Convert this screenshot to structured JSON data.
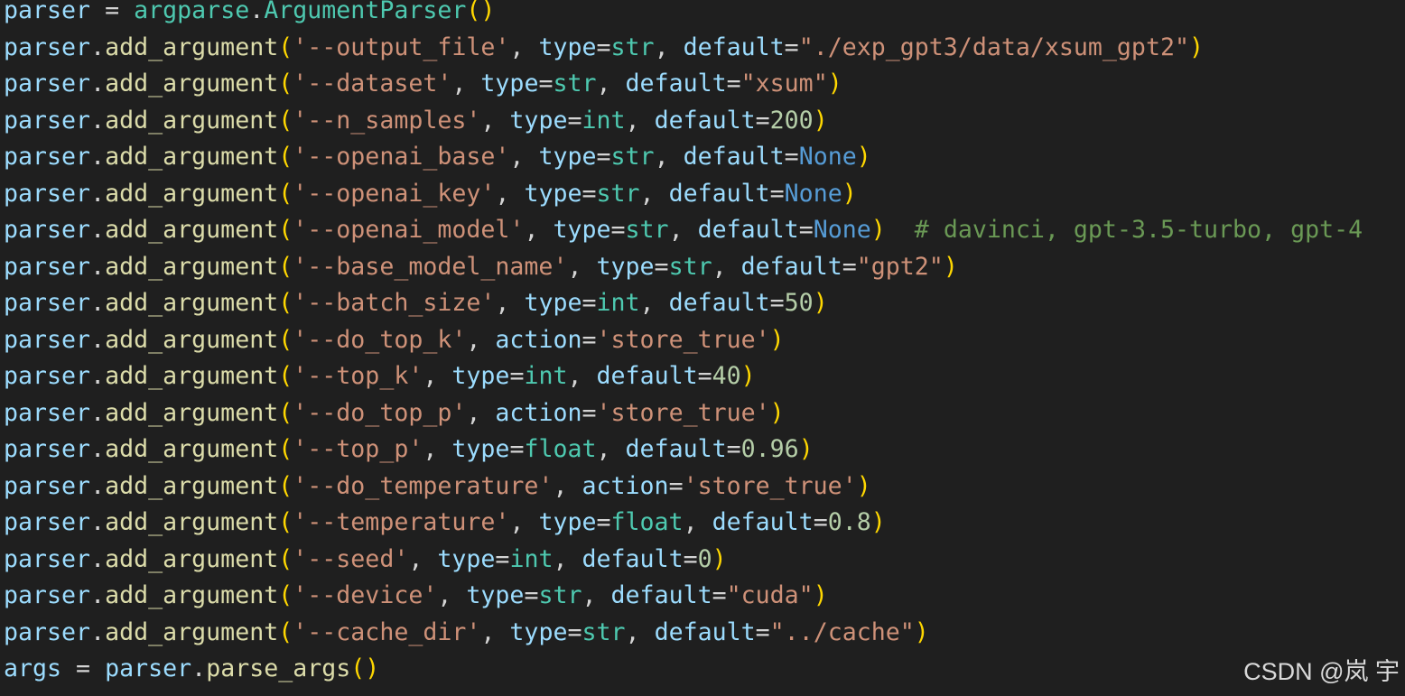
{
  "editor": {
    "theme": {
      "background": "#1f1f1f",
      "var": "#9cdcfe",
      "fn": "#dcdcaa",
      "cls": "#4ec9b0",
      "str": "#ce9178",
      "num": "#b5cea8",
      "kw": "#569cd6",
      "comment": "#6a9955",
      "paren": "#ffd700",
      "plain": "#d4d4d4"
    },
    "lines": [
      [
        [
          "var",
          "parser"
        ],
        [
          "plain",
          " = "
        ],
        [
          "cls",
          "argparse"
        ],
        [
          "plain",
          "."
        ],
        [
          "cls",
          "ArgumentParser"
        ],
        [
          "paren",
          "()"
        ]
      ],
      [
        [
          "var",
          "parser"
        ],
        [
          "plain",
          "."
        ],
        [
          "fn",
          "add_argument"
        ],
        [
          "paren",
          "("
        ],
        [
          "str",
          "'--output_file'"
        ],
        [
          "plain",
          ", "
        ],
        [
          "var",
          "type"
        ],
        [
          "plain",
          "="
        ],
        [
          "type",
          "str"
        ],
        [
          "plain",
          ", "
        ],
        [
          "var",
          "default"
        ],
        [
          "plain",
          "="
        ],
        [
          "str",
          "\"./exp_gpt3/data/xsum_gpt2\""
        ],
        [
          "paren",
          ")"
        ]
      ],
      [
        [
          "var",
          "parser"
        ],
        [
          "plain",
          "."
        ],
        [
          "fn",
          "add_argument"
        ],
        [
          "paren",
          "("
        ],
        [
          "str",
          "'--dataset'"
        ],
        [
          "plain",
          ", "
        ],
        [
          "var",
          "type"
        ],
        [
          "plain",
          "="
        ],
        [
          "type",
          "str"
        ],
        [
          "plain",
          ", "
        ],
        [
          "var",
          "default"
        ],
        [
          "plain",
          "="
        ],
        [
          "str",
          "\"xsum\""
        ],
        [
          "paren",
          ")"
        ]
      ],
      [
        [
          "var",
          "parser"
        ],
        [
          "plain",
          "."
        ],
        [
          "fn",
          "add_argument"
        ],
        [
          "paren",
          "("
        ],
        [
          "str",
          "'--n_samples'"
        ],
        [
          "plain",
          ", "
        ],
        [
          "var",
          "type"
        ],
        [
          "plain",
          "="
        ],
        [
          "type",
          "int"
        ],
        [
          "plain",
          ", "
        ],
        [
          "var",
          "default"
        ],
        [
          "plain",
          "="
        ],
        [
          "num",
          "200"
        ],
        [
          "paren",
          ")"
        ]
      ],
      [
        [
          "var",
          "parser"
        ],
        [
          "plain",
          "."
        ],
        [
          "fn",
          "add_argument"
        ],
        [
          "paren",
          "("
        ],
        [
          "str",
          "'--openai_base'"
        ],
        [
          "plain",
          ", "
        ],
        [
          "var",
          "type"
        ],
        [
          "plain",
          "="
        ],
        [
          "type",
          "str"
        ],
        [
          "plain",
          ", "
        ],
        [
          "var",
          "default"
        ],
        [
          "plain",
          "="
        ],
        [
          "kw",
          "None"
        ],
        [
          "paren",
          ")"
        ]
      ],
      [
        [
          "var",
          "parser"
        ],
        [
          "plain",
          "."
        ],
        [
          "fn",
          "add_argument"
        ],
        [
          "paren",
          "("
        ],
        [
          "str",
          "'--openai_key'"
        ],
        [
          "plain",
          ", "
        ],
        [
          "var",
          "type"
        ],
        [
          "plain",
          "="
        ],
        [
          "type",
          "str"
        ],
        [
          "plain",
          ", "
        ],
        [
          "var",
          "default"
        ],
        [
          "plain",
          "="
        ],
        [
          "kw",
          "None"
        ],
        [
          "paren",
          ")"
        ]
      ],
      [
        [
          "var",
          "parser"
        ],
        [
          "plain",
          "."
        ],
        [
          "fn",
          "add_argument"
        ],
        [
          "paren",
          "("
        ],
        [
          "str",
          "'--openai_model'"
        ],
        [
          "plain",
          ", "
        ],
        [
          "var",
          "type"
        ],
        [
          "plain",
          "="
        ],
        [
          "type",
          "str"
        ],
        [
          "plain",
          ", "
        ],
        [
          "var",
          "default"
        ],
        [
          "plain",
          "="
        ],
        [
          "kw",
          "None"
        ],
        [
          "paren",
          ")"
        ],
        [
          "plain",
          "  "
        ],
        [
          "comment",
          "# davinci, gpt-3.5-turbo, gpt-4"
        ]
      ],
      [
        [
          "var",
          "parser"
        ],
        [
          "plain",
          "."
        ],
        [
          "fn",
          "add_argument"
        ],
        [
          "paren",
          "("
        ],
        [
          "str",
          "'--base_model_name'"
        ],
        [
          "plain",
          ", "
        ],
        [
          "var",
          "type"
        ],
        [
          "plain",
          "="
        ],
        [
          "type",
          "str"
        ],
        [
          "plain",
          ", "
        ],
        [
          "var",
          "default"
        ],
        [
          "plain",
          "="
        ],
        [
          "str",
          "\"gpt2\""
        ],
        [
          "paren",
          ")"
        ]
      ],
      [
        [
          "var",
          "parser"
        ],
        [
          "plain",
          "."
        ],
        [
          "fn",
          "add_argument"
        ],
        [
          "paren",
          "("
        ],
        [
          "str",
          "'--batch_size'"
        ],
        [
          "plain",
          ", "
        ],
        [
          "var",
          "type"
        ],
        [
          "plain",
          "="
        ],
        [
          "type",
          "int"
        ],
        [
          "plain",
          ", "
        ],
        [
          "var",
          "default"
        ],
        [
          "plain",
          "="
        ],
        [
          "num",
          "50"
        ],
        [
          "paren",
          ")"
        ]
      ],
      [
        [
          "var",
          "parser"
        ],
        [
          "plain",
          "."
        ],
        [
          "fn",
          "add_argument"
        ],
        [
          "paren",
          "("
        ],
        [
          "str",
          "'--do_top_k'"
        ],
        [
          "plain",
          ", "
        ],
        [
          "var",
          "action"
        ],
        [
          "plain",
          "="
        ],
        [
          "str",
          "'store_true'"
        ],
        [
          "paren",
          ")"
        ]
      ],
      [
        [
          "var",
          "parser"
        ],
        [
          "plain",
          "."
        ],
        [
          "fn",
          "add_argument"
        ],
        [
          "paren",
          "("
        ],
        [
          "str",
          "'--top_k'"
        ],
        [
          "plain",
          ", "
        ],
        [
          "var",
          "type"
        ],
        [
          "plain",
          "="
        ],
        [
          "type",
          "int"
        ],
        [
          "plain",
          ", "
        ],
        [
          "var",
          "default"
        ],
        [
          "plain",
          "="
        ],
        [
          "num",
          "40"
        ],
        [
          "paren",
          ")"
        ]
      ],
      [
        [
          "var",
          "parser"
        ],
        [
          "plain",
          "."
        ],
        [
          "fn",
          "add_argument"
        ],
        [
          "paren",
          "("
        ],
        [
          "str",
          "'--do_top_p'"
        ],
        [
          "plain",
          ", "
        ],
        [
          "var",
          "action"
        ],
        [
          "plain",
          "="
        ],
        [
          "str",
          "'store_true'"
        ],
        [
          "paren",
          ")"
        ]
      ],
      [
        [
          "var",
          "parser"
        ],
        [
          "plain",
          "."
        ],
        [
          "fn",
          "add_argument"
        ],
        [
          "paren",
          "("
        ],
        [
          "str",
          "'--top_p'"
        ],
        [
          "plain",
          ", "
        ],
        [
          "var",
          "type"
        ],
        [
          "plain",
          "="
        ],
        [
          "type",
          "float"
        ],
        [
          "plain",
          ", "
        ],
        [
          "var",
          "default"
        ],
        [
          "plain",
          "="
        ],
        [
          "num",
          "0.96"
        ],
        [
          "paren",
          ")"
        ]
      ],
      [
        [
          "var",
          "parser"
        ],
        [
          "plain",
          "."
        ],
        [
          "fn",
          "add_argument"
        ],
        [
          "paren",
          "("
        ],
        [
          "str",
          "'--do_temperature'"
        ],
        [
          "plain",
          ", "
        ],
        [
          "var",
          "action"
        ],
        [
          "plain",
          "="
        ],
        [
          "str",
          "'store_true'"
        ],
        [
          "paren",
          ")"
        ]
      ],
      [
        [
          "var",
          "parser"
        ],
        [
          "plain",
          "."
        ],
        [
          "fn",
          "add_argument"
        ],
        [
          "paren",
          "("
        ],
        [
          "str",
          "'--temperature'"
        ],
        [
          "plain",
          ", "
        ],
        [
          "var",
          "type"
        ],
        [
          "plain",
          "="
        ],
        [
          "type",
          "float"
        ],
        [
          "plain",
          ", "
        ],
        [
          "var",
          "default"
        ],
        [
          "plain",
          "="
        ],
        [
          "num",
          "0.8"
        ],
        [
          "paren",
          ")"
        ]
      ],
      [
        [
          "var",
          "parser"
        ],
        [
          "plain",
          "."
        ],
        [
          "fn",
          "add_argument"
        ],
        [
          "paren",
          "("
        ],
        [
          "str",
          "'--seed'"
        ],
        [
          "plain",
          ", "
        ],
        [
          "var",
          "type"
        ],
        [
          "plain",
          "="
        ],
        [
          "type",
          "int"
        ],
        [
          "plain",
          ", "
        ],
        [
          "var",
          "default"
        ],
        [
          "plain",
          "="
        ],
        [
          "num",
          "0"
        ],
        [
          "paren",
          ")"
        ]
      ],
      [
        [
          "var",
          "parser"
        ],
        [
          "plain",
          "."
        ],
        [
          "fn",
          "add_argument"
        ],
        [
          "paren",
          "("
        ],
        [
          "str",
          "'--device'"
        ],
        [
          "plain",
          ", "
        ],
        [
          "var",
          "type"
        ],
        [
          "plain",
          "="
        ],
        [
          "type",
          "str"
        ],
        [
          "plain",
          ", "
        ],
        [
          "var",
          "default"
        ],
        [
          "plain",
          "="
        ],
        [
          "str",
          "\"cuda\""
        ],
        [
          "paren",
          ")"
        ]
      ],
      [
        [
          "var",
          "parser"
        ],
        [
          "plain",
          "."
        ],
        [
          "fn",
          "add_argument"
        ],
        [
          "paren",
          "("
        ],
        [
          "str",
          "'--cache_dir'"
        ],
        [
          "plain",
          ", "
        ],
        [
          "var",
          "type"
        ],
        [
          "plain",
          "="
        ],
        [
          "type",
          "str"
        ],
        [
          "plain",
          ", "
        ],
        [
          "var",
          "default"
        ],
        [
          "plain",
          "="
        ],
        [
          "str",
          "\"../cache\""
        ],
        [
          "paren",
          ")"
        ]
      ],
      [
        [
          "var",
          "args"
        ],
        [
          "plain",
          " = "
        ],
        [
          "var",
          "parser"
        ],
        [
          "plain",
          "."
        ],
        [
          "fn",
          "parse_args"
        ],
        [
          "paren",
          "()"
        ]
      ]
    ]
  },
  "watermark": {
    "text": "CSDN @岚 宇"
  }
}
